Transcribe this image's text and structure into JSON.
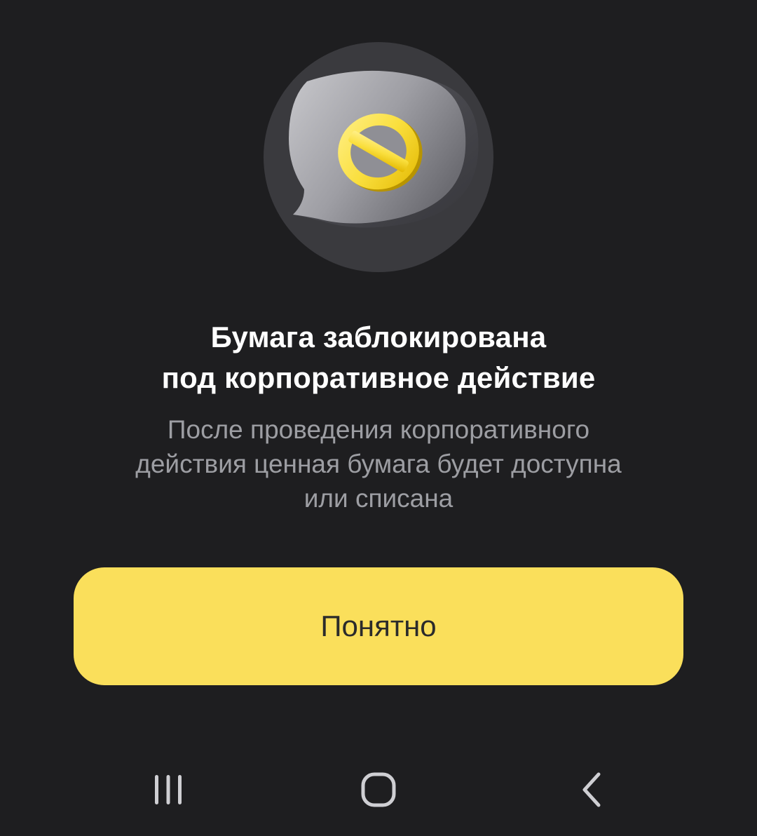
{
  "dialog": {
    "icon": "blocked-message-icon",
    "title_line1": "Бумага заблокирована",
    "title_line2": "под корпоративное действие",
    "body_line1": "После проведения корпоративного",
    "body_line2": "действия ценная бумага будет доступна",
    "body_line3": "или списана",
    "confirm_label": "Понятно"
  },
  "navbar": {
    "recents_icon": "recents-icon",
    "home_icon": "home-icon",
    "back_icon": "back-icon"
  },
  "colors": {
    "background": "#1e1e20",
    "accent": "#fadf5b",
    "title_text": "#ffffff",
    "secondary_text": "#9d9ea3"
  }
}
